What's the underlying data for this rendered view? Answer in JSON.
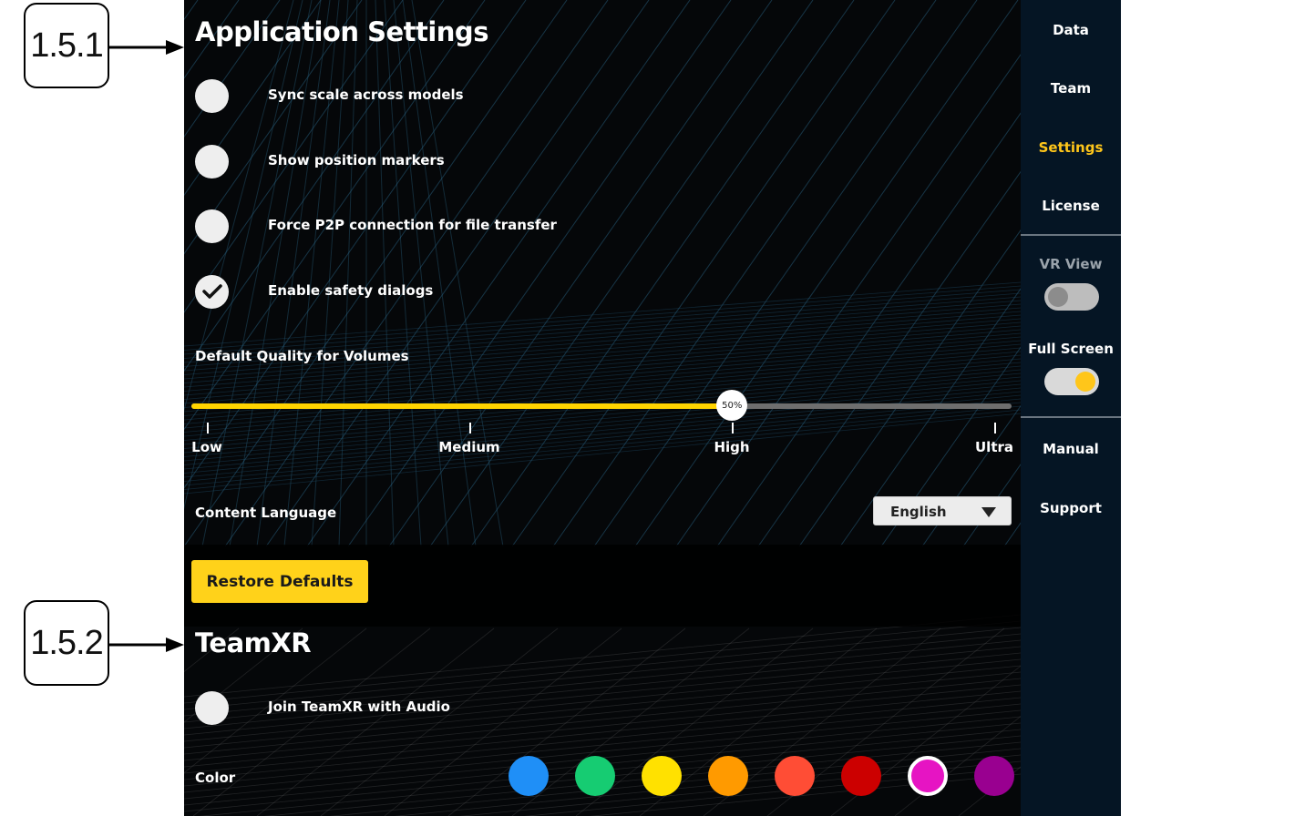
{
  "callouts": [
    {
      "label": "1.5.1"
    },
    {
      "label": "1.5.2"
    }
  ],
  "settings": {
    "title": "Application Settings",
    "options": [
      {
        "label": "Sync scale across models",
        "checked": false
      },
      {
        "label": "Show position markers",
        "checked": false
      },
      {
        "label": "Force P2P connection for file transfer",
        "checked": false
      },
      {
        "label": "Enable safety dialogs",
        "checked": true
      }
    ],
    "quality": {
      "label": "Default Quality for Volumes",
      "value_label": "50%",
      "value_fraction": 0.667,
      "ticks": [
        "Low",
        "Medium",
        "High",
        "Ultra"
      ]
    },
    "language": {
      "label": "Content Language",
      "value": "English"
    },
    "restore_label": "Restore Defaults"
  },
  "teamxr": {
    "title": "TeamXR",
    "join_audio": {
      "label": "Join TeamXR with Audio",
      "checked": false
    },
    "color_label": "Color",
    "colors": [
      {
        "hex": "#1f8ff7",
        "selected": false
      },
      {
        "hex": "#16cc72",
        "selected": false
      },
      {
        "hex": "#ffe100",
        "selected": false
      },
      {
        "hex": "#ff9a00",
        "selected": false
      },
      {
        "hex": "#ff4d35",
        "selected": false
      },
      {
        "hex": "#cc0000",
        "selected": false
      },
      {
        "hex": "#e614c3",
        "selected": true
      },
      {
        "hex": "#990090",
        "selected": false
      }
    ]
  },
  "sidebar": {
    "items": [
      {
        "label": "Data",
        "active": false
      },
      {
        "label": "Team",
        "active": false
      },
      {
        "label": "Settings",
        "active": true
      },
      {
        "label": "License",
        "active": false
      }
    ],
    "vr_view": {
      "label": "VR View",
      "on": false
    },
    "full_screen": {
      "label": "Full Screen",
      "on": true
    },
    "bottom_items": [
      {
        "label": "Manual"
      },
      {
        "label": "Support"
      }
    ]
  },
  "colors": {
    "accent": "#ffd21a",
    "panel_bg": "#050709",
    "sidebar_bg": "#051524"
  }
}
